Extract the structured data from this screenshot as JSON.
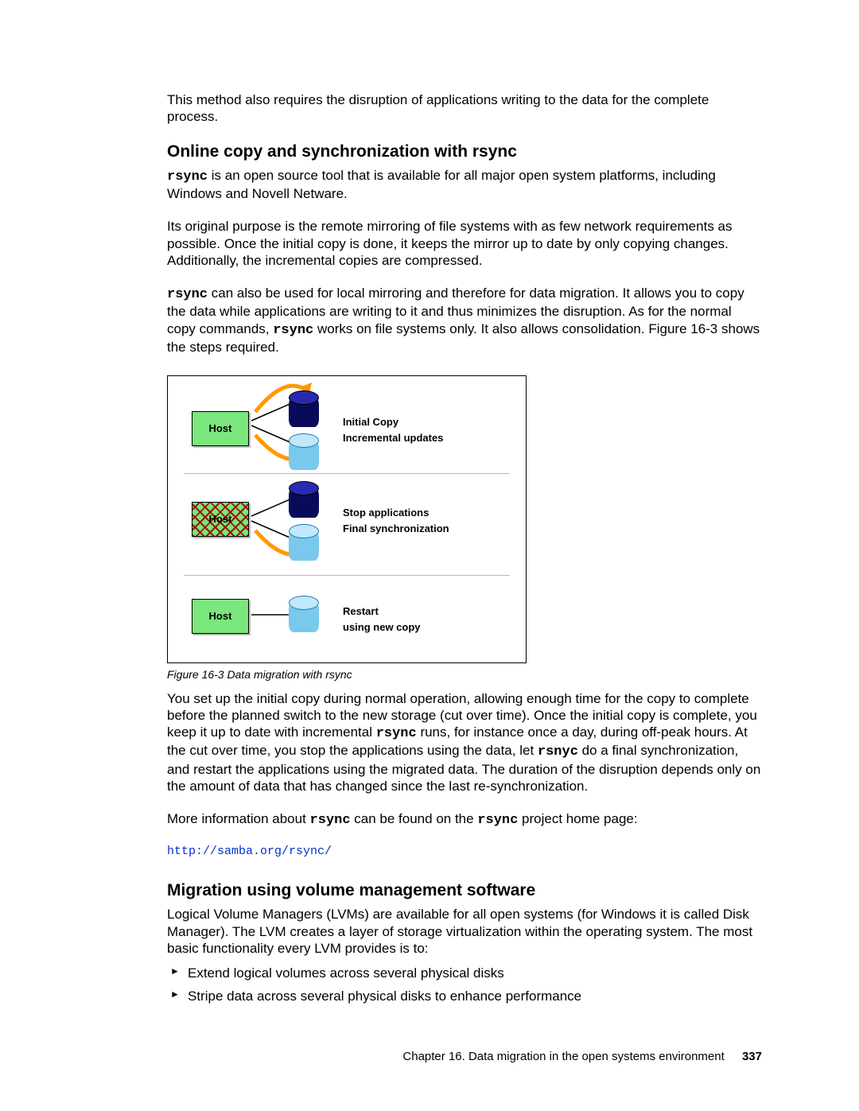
{
  "intro": "This method also requires the disruption of applications writing to the data for the complete process.",
  "h1": "Online copy and synchronization with rsync",
  "p1a": " is an open source tool that is available for all major open system platforms, including Windows and Novell Netware.",
  "p2": "Its original purpose is the remote mirroring of file systems with as few network requirements as possible. Once the initial copy is done, it keeps the mirror up to date by only copying changes. Additionally, the incremental copies are compressed.",
  "p3a": " can also be used for local mirroring and therefore for data migration. It allows you to copy the data while applications are writing to it and thus minimizes the disruption. As for the normal copy commands, ",
  "p3b": " works on file systems only. It also allows consolidation. Figure 16-3 shows the steps required.",
  "figure": {
    "caption": "Figure 16-3   Data migration with rsync",
    "row1": {
      "host": "Host",
      "l1": "Initial Copy",
      "l2": "Incremental updates"
    },
    "row2": {
      "host": "Host",
      "l1": "Stop applications",
      "l2": "Final synchronization"
    },
    "row3": {
      "host": "Host",
      "l1": "Restart",
      "l2": "using new copy"
    }
  },
  "p4a": "You set up the initial copy during normal operation, allowing enough time for the copy to complete before the planned switch to the new storage (cut over time). Once the initial copy is complete, you keep it up to date with incremental ",
  "p4b": " runs, for instance once a day, during off-peak hours. At the cut over time, you stop the applications using the data, let ",
  "p4c": " do a final synchronization, and restart the applications using the migrated data. The duration of the disruption depends only on the amount of data that has changed since the last re-synchronization.",
  "p5a": "More information about ",
  "p5b": " can be found on the ",
  "p5c": " project home page:",
  "link": "http://samba.org/rsync/",
  "h2": "Migration using volume management software",
  "p6": "Logical Volume Managers (LVMs) are available for all open systems (for Windows it is called Disk Manager). The LVM creates a layer of storage virtualization within the operating system. The most basic functionality every LVM provides is to:",
  "bullets": [
    "Extend logical volumes across several physical disks",
    "Stripe data across several physical disks to enhance performance"
  ],
  "code": {
    "rsync": "rsync",
    "rsnyc": "rsnyc"
  },
  "footer": {
    "chapter": "Chapter 16. Data migration in the open systems environment",
    "page": "337"
  }
}
